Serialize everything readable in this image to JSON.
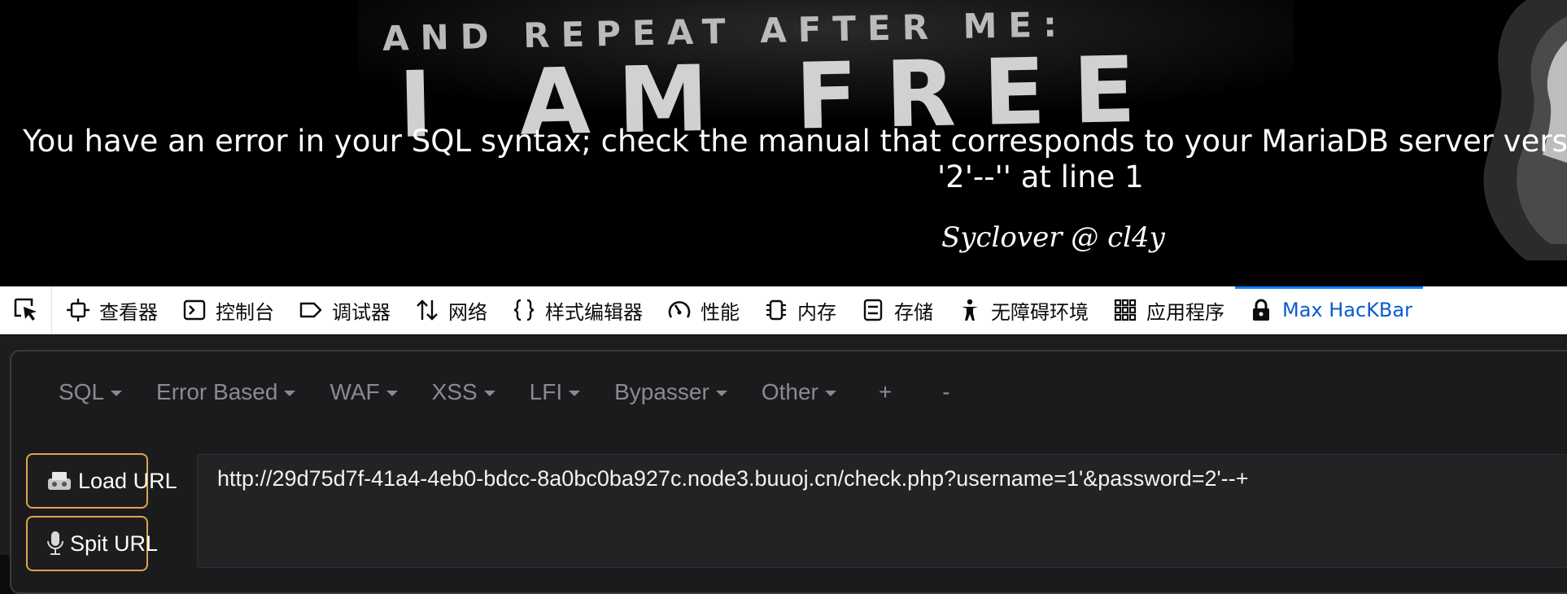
{
  "page": {
    "slogan_line1": "AND REPEAT AFTER ME:",
    "slogan_line2": "I AM FREE",
    "error_line1": "You have an error in your SQL syntax; check the manual that corresponds to your MariaDB server versio",
    "error_line2": "'2'--'' at line 1",
    "signature": "Syclover @ cl4y"
  },
  "devtools": {
    "tabs": [
      {
        "label": "查看器",
        "icon": "inspector-icon"
      },
      {
        "label": "控制台",
        "icon": "console-icon"
      },
      {
        "label": "调试器",
        "icon": "debugger-icon"
      },
      {
        "label": "网络",
        "icon": "network-icon"
      },
      {
        "label": "样式编辑器",
        "icon": "style-editor-icon"
      },
      {
        "label": "性能",
        "icon": "performance-icon"
      },
      {
        "label": "内存",
        "icon": "memory-icon"
      },
      {
        "label": "存储",
        "icon": "storage-icon"
      },
      {
        "label": "无障碍环境",
        "icon": "accessibility-icon"
      },
      {
        "label": "应用程序",
        "icon": "application-icon"
      },
      {
        "label": "Max HacKBar",
        "icon": "hackbar-lock-icon",
        "active": true
      }
    ],
    "active_color": "#0a84ff"
  },
  "hackbar": {
    "menu": [
      "SQL",
      "Error Based",
      "WAF",
      "XSS",
      "LFI",
      "Bypasser",
      "Other",
      "+",
      "-"
    ],
    "load_url_label": "Load URL",
    "split_url_label": "Spit URL",
    "url_value": "http://29d75d7f-41a4-4eb0-bdcc-8a0bc0ba927c.node3.buuoj.cn/check.php?username=1'&password=2'--+",
    "button_border_color": "#e0a44a"
  }
}
